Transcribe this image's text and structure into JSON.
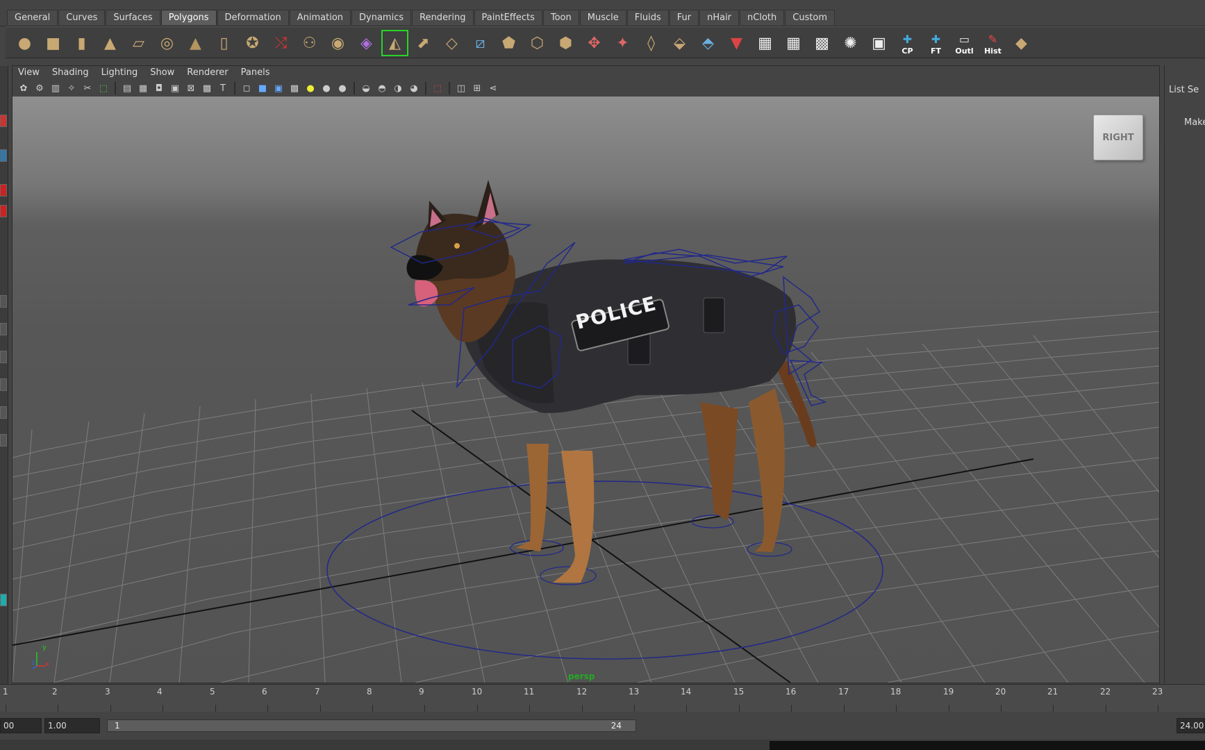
{
  "shelf": {
    "tabs": [
      "General",
      "Curves",
      "Surfaces",
      "Polygons",
      "Deformation",
      "Animation",
      "Dynamics",
      "Rendering",
      "PaintEffects",
      "Toon",
      "Muscle",
      "Fluids",
      "Fur",
      "nHair",
      "nCloth",
      "Custom"
    ],
    "active_tab": "Polygons",
    "icons": [
      {
        "name": "poly-sphere-icon",
        "glyph": "●",
        "color": "#c8a873"
      },
      {
        "name": "poly-cube-icon",
        "glyph": "■",
        "color": "#c8a873"
      },
      {
        "name": "poly-cylinder-icon",
        "glyph": "▮",
        "color": "#c8a873"
      },
      {
        "name": "poly-cone-icon",
        "glyph": "▲",
        "color": "#c8a873"
      },
      {
        "name": "poly-plane-icon",
        "glyph": "▱",
        "color": "#c8a873"
      },
      {
        "name": "poly-torus-icon",
        "glyph": "◎",
        "color": "#c8a873"
      },
      {
        "name": "poly-pyramid-icon",
        "glyph": "▲",
        "color": "#b59560"
      },
      {
        "name": "poly-pipe-icon",
        "glyph": "▯",
        "color": "#c8a873"
      },
      {
        "name": "soccer-ball-icon",
        "glyph": "✪",
        "color": "#c8a873"
      },
      {
        "name": "separate-icon",
        "glyph": "⤭",
        "color": "#d33"
      },
      {
        "name": "combine-icon",
        "glyph": "⚇",
        "color": "#c8a873"
      },
      {
        "name": "smooth-icon",
        "glyph": "◉",
        "color": "#c8a873"
      },
      {
        "name": "mirror-geometry-icon",
        "glyph": "◈",
        "color": "#b070e0"
      },
      {
        "name": "create-polygon-tool-icon",
        "glyph": "◭",
        "color": "#c8a873"
      },
      {
        "name": "append-polygon-icon",
        "glyph": "⬈",
        "color": "#c8a873"
      },
      {
        "name": "split-polygon-icon",
        "glyph": "◇",
        "color": "#c8a873"
      },
      {
        "name": "insert-edge-loop-icon",
        "glyph": "⧄",
        "color": "#6ab0e0"
      },
      {
        "name": "offset-edge-loop-icon",
        "glyph": "⬟",
        "color": "#c8a873"
      },
      {
        "name": "extrude-icon",
        "glyph": "⬡",
        "color": "#c8a873"
      },
      {
        "name": "bridge-icon",
        "glyph": "⬢",
        "color": "#c8a873"
      },
      {
        "name": "merge-vertices-icon",
        "glyph": "✥",
        "color": "#d66"
      },
      {
        "name": "collapse-icon",
        "glyph": "✦",
        "color": "#d66"
      },
      {
        "name": "fill-hole-icon",
        "glyph": "◊",
        "color": "#c8a873"
      },
      {
        "name": "sculpt-geometry-icon",
        "glyph": "⬙",
        "color": "#c8a873"
      },
      {
        "name": "transfer-attributes-icon",
        "glyph": "⬘",
        "color": "#6ab0e0"
      },
      {
        "name": "planar-mapping-icon",
        "glyph": "▼",
        "color": "#d44"
      },
      {
        "name": "uv-layout-icon",
        "glyph": "▦",
        "color": "#eee"
      },
      {
        "name": "uv-snapshot-icon",
        "glyph": "▦",
        "color": "#eee"
      },
      {
        "name": "uv-move-icon",
        "glyph": "▩",
        "color": "#eee"
      },
      {
        "name": "uv-smooth-icon",
        "glyph": "✺",
        "color": "#eee"
      },
      {
        "name": "uv-texture-editor-icon",
        "glyph": "▣",
        "color": "#eee"
      },
      {
        "name": "center-pivot-icon",
        "glyph": "✚",
        "color": "#4ad",
        "label": "CP"
      },
      {
        "name": "freeze-transforms-icon",
        "glyph": "✚",
        "color": "#4ad",
        "label": "FT"
      },
      {
        "name": "outliner-icon",
        "glyph": "▭",
        "color": "#eee",
        "label": "Outl"
      },
      {
        "name": "history-icon",
        "glyph": "✎",
        "color": "#e44",
        "label": "Hist"
      },
      {
        "name": "layers-icon",
        "glyph": "◆",
        "color": "#c8a873"
      }
    ]
  },
  "panel": {
    "menus": [
      "View",
      "Shading",
      "Lighting",
      "Show",
      "Renderer",
      "Panels"
    ],
    "camera_label": "persp",
    "viewcube_label": "RIGHT",
    "vest_text": "POLICE",
    "axis": {
      "y": "y",
      "z": "z",
      "x": "x"
    }
  },
  "right_panel": {
    "header": "List  Se",
    "body": "Make"
  },
  "timeline": {
    "frames": [
      "1",
      "2",
      "3",
      "4",
      "5",
      "6",
      "7",
      "8",
      "9",
      "10",
      "11",
      "12",
      "13",
      "14",
      "15",
      "16",
      "17",
      "18",
      "19",
      "20",
      "21",
      "22",
      "23"
    ],
    "playback_start": "00",
    "start_time": "1.00",
    "range_start": "1",
    "range_end": "24",
    "end_time": "24.00"
  }
}
